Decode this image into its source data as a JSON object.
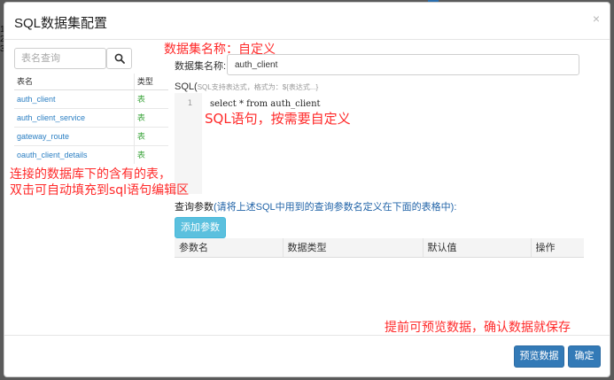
{
  "background": {
    "fragment": "1\n2\n3"
  },
  "modal": {
    "title": "SQL数据集配置",
    "close": "×"
  },
  "search": {
    "placeholder": "表名查询"
  },
  "tables": {
    "headers": [
      "表名",
      "类型"
    ],
    "rows": [
      {
        "name": "auth_client",
        "type": "表"
      },
      {
        "name": "auth_client_service",
        "type": "表"
      },
      {
        "name": "gateway_route",
        "type": "表"
      },
      {
        "name": "oauth_client_details",
        "type": "表"
      }
    ]
  },
  "dataset": {
    "name_label": "数据集名称:",
    "name_value": "auth_client"
  },
  "sql": {
    "label": "SQL(",
    "hint": "SQL支持表达式，格式为：${表达式...}",
    "line_number": "1",
    "code": "select * from auth_client"
  },
  "params": {
    "title": "查询参数",
    "hint": "(请将上述SQL中用到的查询参数名定义在下面的表格中):",
    "add_button": "添加参数",
    "headers": [
      "参数名",
      "数据类型",
      "默认值",
      "操作"
    ]
  },
  "footer": {
    "preview": "预览数据",
    "confirm": "确定"
  },
  "annotations": {
    "name_note": "数据集名称：自定义",
    "sql_note": "SQL语句，按需要自定义",
    "table_note_1": "连接的数据库下的含有的表，",
    "table_note_2": "双击可自动填充到sql语句编辑区",
    "preview_note": "提前可预览数据，确认数据就保存"
  },
  "colors": {
    "primary": "#337ab7",
    "info": "#5bc0de",
    "annotation": "#ff2a2a",
    "link": "#2b7fc3",
    "type_tag": "#3ca43c"
  }
}
